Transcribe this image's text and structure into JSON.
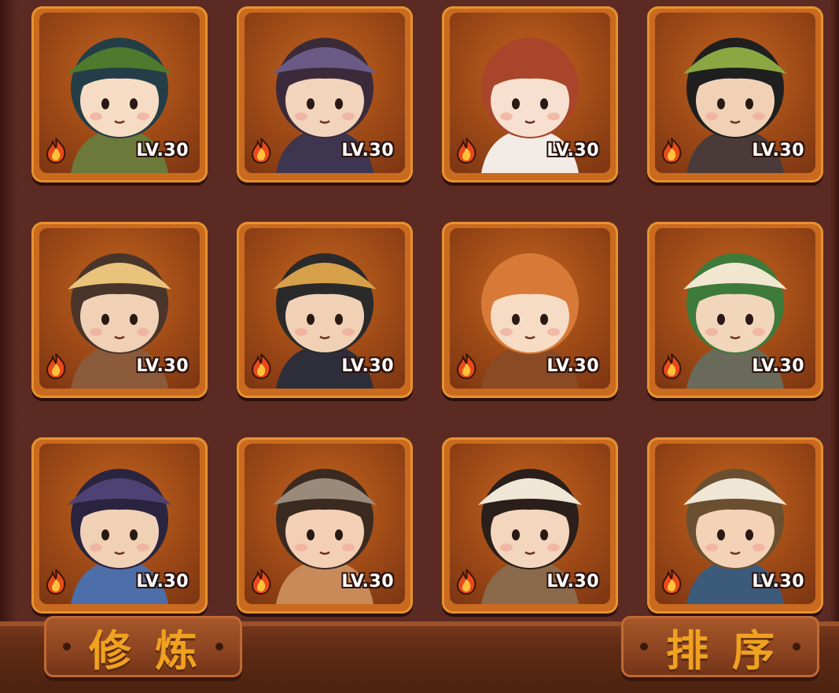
{
  "heroes": [
    {
      "level": "LV.30",
      "hair": "#243e47",
      "skin": "#f6dcc4",
      "hat": "#4f7a2e",
      "outfit": "#6b7a3a"
    },
    {
      "level": "LV.30",
      "hair": "#3b2b3a",
      "skin": "#f2d3bb",
      "hat": "#6a5a86",
      "outfit": "#3e3550"
    },
    {
      "level": "LV.30",
      "hair": "#a8452a",
      "skin": "#f7e0cf",
      "hat": "",
      "outfit": "#f3ece6"
    },
    {
      "level": "LV.30",
      "hair": "#1f1f1f",
      "skin": "#f1d1b6",
      "hat": "#8aa741",
      "outfit": "#4a3b3a"
    },
    {
      "level": "LV.30",
      "hair": "#4a352b",
      "skin": "#f1d1b6",
      "hat": "#e8c37b",
      "outfit": "#8b5a3a"
    },
    {
      "level": "LV.30",
      "hair": "#2a2a2a",
      "skin": "#f1d1b6",
      "hat": "#d6a04a",
      "outfit": "#2e2e3a"
    },
    {
      "level": "LV.30",
      "hair": "#d77a37",
      "skin": "#f6dcc4",
      "hat": "",
      "outfit": "#8a4a24"
    },
    {
      "level": "LV.30",
      "hair": "#3e7a3a",
      "skin": "#f2d6bc",
      "hat": "#f1e6d0",
      "outfit": "#6a6a5a"
    },
    {
      "level": "LV.30",
      "hair": "#2b2440",
      "skin": "#f1d1b6",
      "hat": "#4d4273",
      "outfit": "#4d6ea8"
    },
    {
      "level": "LV.30",
      "hair": "#3a2a20",
      "skin": "#f3cfb5",
      "hat": "#9a8a7a",
      "outfit": "#c98a5a"
    },
    {
      "level": "LV.30",
      "hair": "#2a1f1a",
      "skin": "#f3d6bd",
      "hat": "#efe6d6",
      "outfit": "#8a6a4a"
    },
    {
      "level": "LV.30",
      "hair": "#6a5030",
      "skin": "#f3d2b8",
      "hat": "#efe6d6",
      "outfit": "#3c5a7a"
    }
  ],
  "buttons": {
    "cultivate": "修炼",
    "sort": "排序"
  },
  "colors": {
    "accent": "#f0a21f",
    "card_border": "#e6922f",
    "panel": "#5b2a22"
  }
}
